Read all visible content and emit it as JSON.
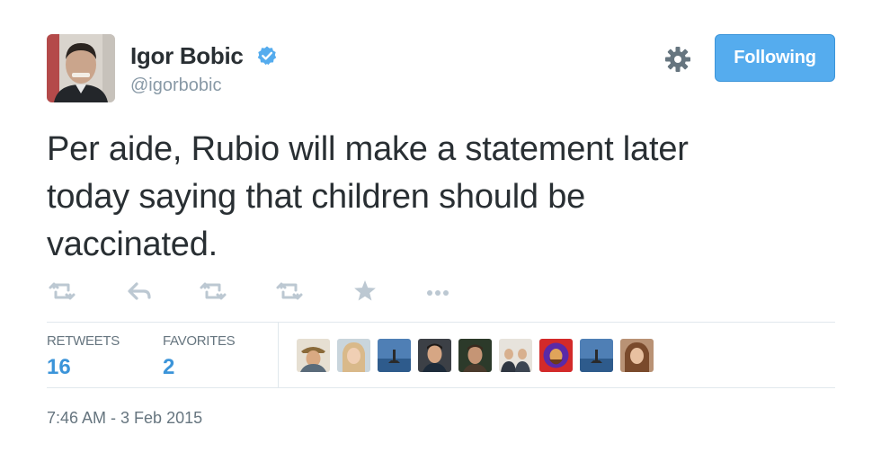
{
  "user": {
    "name": "Igor Bobic",
    "handle": "@igorbobic",
    "verified": true
  },
  "follow_button": {
    "label": "Following"
  },
  "tweet": {
    "lines": [
      "Per aide, Rubio will make a statement later",
      "today saying that children should be",
      "vaccinated."
    ]
  },
  "actions": {
    "icons": [
      "retweet-icon",
      "reply-icon",
      "retweet-icon",
      "retweet-icon",
      "favorite-star-icon",
      "more-dots-icon"
    ]
  },
  "stats": {
    "retweets_label": "RETWEETS",
    "retweets_value": "16",
    "favorites_label": "FAVORITES",
    "favorites_value": "2"
  },
  "favoriters": {
    "count": 9
  },
  "timestamp": "7:46 AM - 3 Feb 2015",
  "colors": {
    "accent": "#55acee",
    "link": "#3b94d9",
    "text": "#292f33",
    "muted": "#8899a6",
    "divider": "#e1e8ed"
  }
}
